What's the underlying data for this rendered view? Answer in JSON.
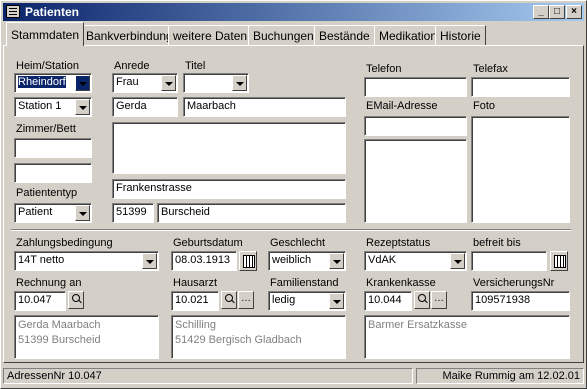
{
  "window": {
    "title": "Patienten"
  },
  "tabs": [
    "Stammdaten",
    "Bankverbindung",
    "weitere Daten",
    "Buchungen",
    "Bestände",
    "Medikation",
    "Historie"
  ],
  "labels": {
    "heim_station": "Heim/Station",
    "anrede": "Anrede",
    "titel": "Titel",
    "zimmer_bett": "Zimmer/Bett",
    "patiententyp": "Patiententyp",
    "telefon": "Telefon",
    "telefax": "Telefax",
    "email": "EMail-Adresse",
    "foto": "Foto",
    "zahlungsbedingung": "Zahlungsbedingung",
    "geburtsdatum": "Geburtsdatum",
    "geschlecht": "Geschlecht",
    "rezeptstatus": "Rezeptstatus",
    "befreit_bis": "befreit bis",
    "rechnung_an": "Rechnung an",
    "hausarzt": "Hausarzt",
    "familienstand": "Familienstand",
    "krankenkasse": "Krankenkasse",
    "versicherungsnr": "VersicherungsNr"
  },
  "values": {
    "heim": "Rheindorf",
    "station": "Station 1",
    "anrede": "Frau",
    "titel": "",
    "vorname": "Gerda",
    "nachname": "Maarbach",
    "strasse": "Frankenstrasse",
    "plz": "51399",
    "ort": "Burscheid",
    "patiententyp": "Patient",
    "zahlungsbedingung": "14T netto",
    "geburtsdatum": "08.03.1913",
    "geschlecht": "weiblich",
    "rezeptstatus": "VdAK",
    "befreit_bis": "",
    "rechnung_an": "10.047",
    "hausarzt": "10.021",
    "familienstand": "ledig",
    "krankenkasse": "10.044",
    "versicherungsnr": "109571938"
  },
  "info": {
    "rechnung_line1": "Gerda Maarbach",
    "rechnung_line2": "51399 Burscheid",
    "hausarzt_line1": "Schilling",
    "hausarzt_line2": "51429 Bergisch Gladbach",
    "kasse_line1": "Barmer Ersatzkasse"
  },
  "status": {
    "left": "AdressenNr 10.047",
    "right": "Maike Rummig am 12.02.01"
  }
}
